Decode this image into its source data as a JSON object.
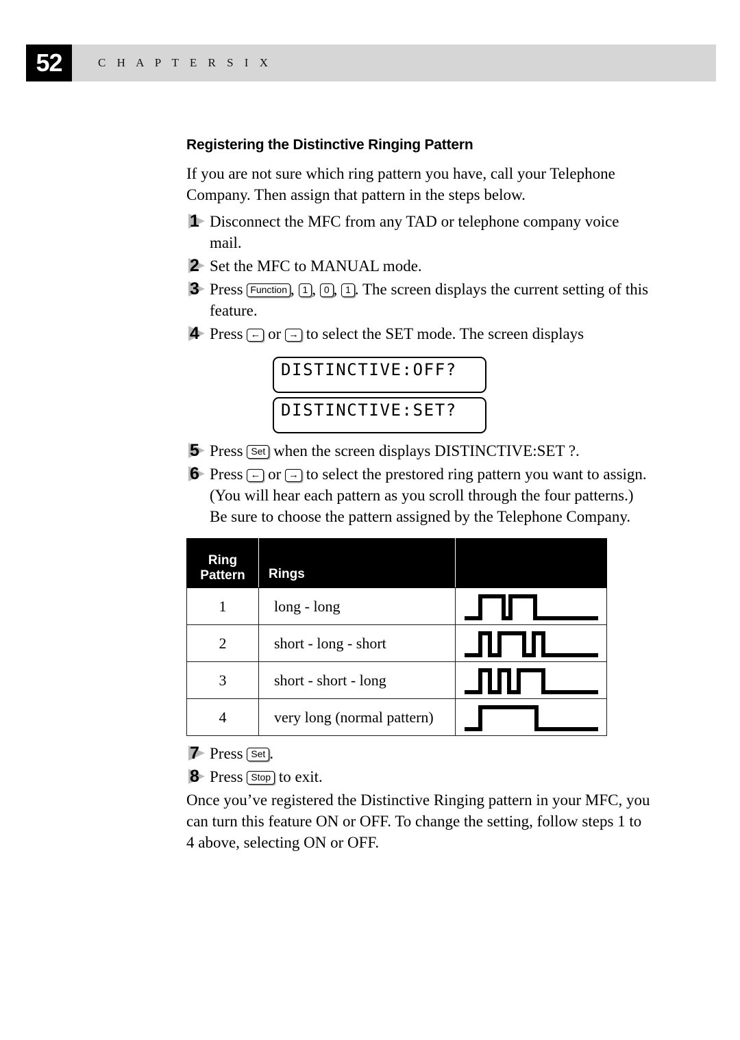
{
  "running_head": {
    "page_number": "52",
    "chapter_label": "C H A P T E R   S I X"
  },
  "section": {
    "title": "Registering the Distinctive Ringing Pattern",
    "intro": "If you are not sure which ring pattern you have, call your Telephone Company. Then assign that pattern in the steps below."
  },
  "steps": [
    {
      "number": "1",
      "text_before": "Disconnect the MFC from any TAD or telephone company voice mail.",
      "keys": [],
      "text_after": ""
    },
    {
      "number": "2",
      "text_before": "Set the MFC to MANUAL mode.",
      "keys": [],
      "text_after": ""
    },
    {
      "number": "3",
      "text_before": "Press ",
      "keys": [
        "Function",
        "1",
        "0",
        "1"
      ],
      "text_after": ". The screen displays the current setting of this feature."
    },
    {
      "number": "4",
      "text_before": "Press ",
      "keys": [
        "←",
        "→"
      ],
      "text_after": " to select the SET mode. The screen displays"
    },
    {
      "number": "5",
      "text_before": "Press ",
      "keys": [
        "Set"
      ],
      "text_after": " when the screen displays DISTINCTIVE:SET ?."
    },
    {
      "number": "6",
      "text_before": "Press ",
      "keys": [
        "←",
        "→"
      ],
      "text_after": " to select the prestored ring pattern you want to assign. (You will hear each pattern as you scroll through the four patterns.) Be sure to choose the pattern assigned by the Telephone Company."
    },
    {
      "number": "7",
      "text_before": "Press ",
      "keys": [
        "Set"
      ],
      "text_after": "."
    },
    {
      "number": "8",
      "text_before": "Press ",
      "keys": [
        "Stop"
      ],
      "text_after": " to exit."
    }
  ],
  "step3_key1": "Function",
  "step3_key2": "1",
  "step3_key3": "0",
  "step3_key4": "1",
  "step3_lead": "Press ",
  "step3_tail": ". The screen displays the current setting of this feature.",
  "step4_lead": "Press ",
  "step4_mid": " or ",
  "step4_tail": " to select the SET mode. The screen displays",
  "step5_lead": "Press ",
  "step5_tail": " when the screen displays DISTINCTIVE:SET ?.",
  "step6_lead": "Press ",
  "step6_mid": " or ",
  "step6_tail": " to select the prestored ring pattern you want to assign. (You will hear each pattern as you scroll through the four patterns.) Be sure to choose the pattern assigned by the Telephone Company.",
  "step7_lead": "Press ",
  "step7_tail": ".",
  "step8_lead": "Press ",
  "step8_tail": " to exit.",
  "keys": {
    "function": "Function",
    "one": "1",
    "zero": "0",
    "one_b": "1",
    "left_arrow": "←",
    "right_arrow": "→",
    "set": "Set",
    "stop": "Stop",
    "comma": ", "
  },
  "lcd_displays": [
    {
      "text": "DISTINCTIVE:OFF?"
    },
    {
      "text": "DISTINCTIVE:SET?"
    }
  ],
  "ring_table": {
    "headers": {
      "pattern_line1": "Ring",
      "pattern_line2": "Pattern",
      "rings": "Rings",
      "waveform": ""
    },
    "rows": [
      {
        "pattern": "1",
        "rings": "long - long",
        "waveform": "long-long"
      },
      {
        "pattern": "2",
        "rings": "short - long - short",
        "waveform": "short-long-short"
      },
      {
        "pattern": "3",
        "rings": "short - short - long",
        "waveform": "short-short-long"
      },
      {
        "pattern": "4",
        "rings": "very long (normal pattern)",
        "waveform": "very-long"
      }
    ]
  },
  "closing_paragraph": "Once you’ve registered the Distinctive Ringing pattern in your MFC, you can turn this feature ON or OFF.  To change the setting, follow steps 1 to 4 above, selecting ON or OFF.",
  "colors": {
    "band_gray": "#d6d6d6",
    "marker_gray": "#b9b9b9",
    "ink": "#000000",
    "paper": "#ffffff"
  }
}
